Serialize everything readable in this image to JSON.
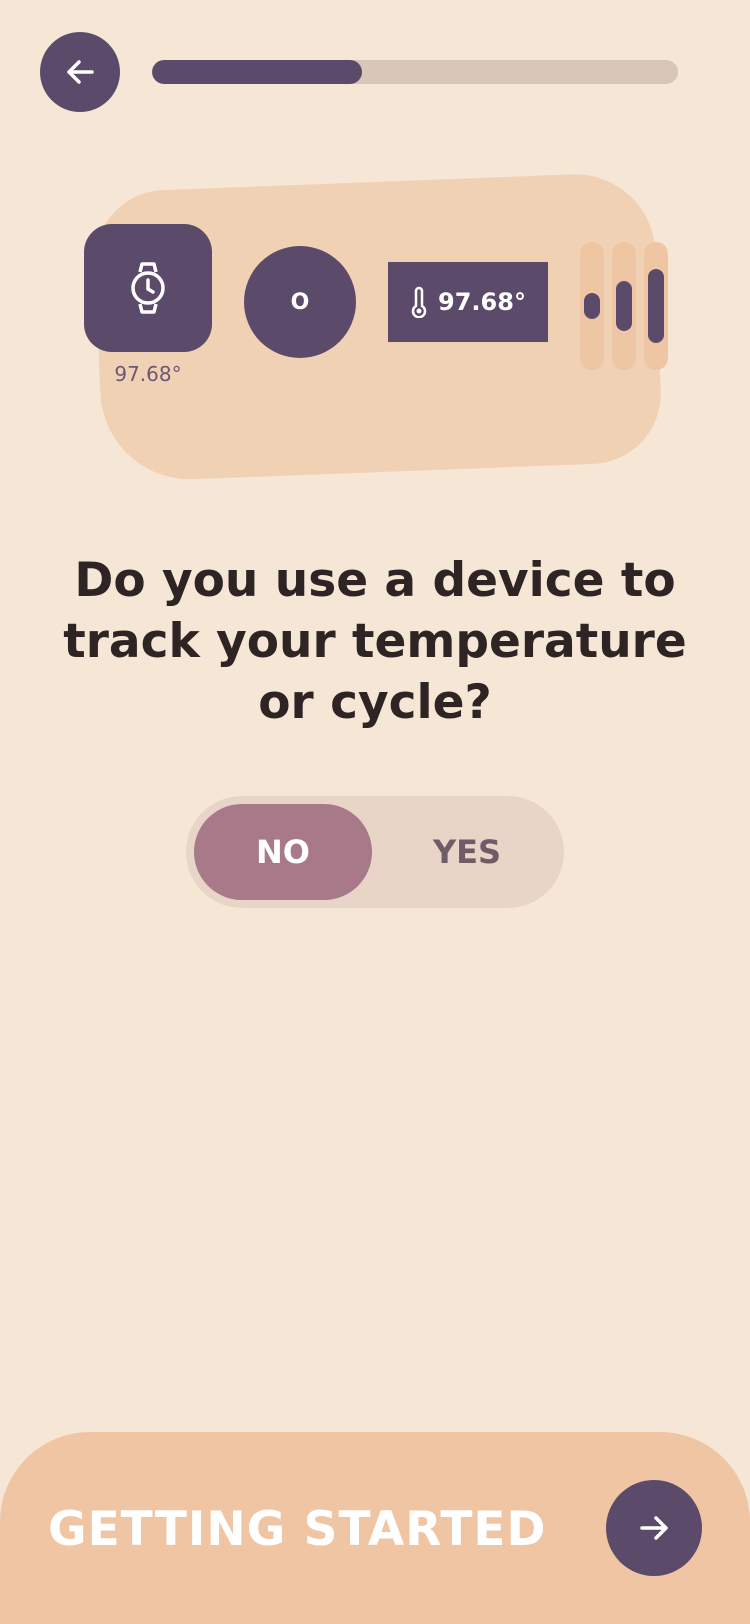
{
  "header": {
    "back_icon": "arrow-left-icon",
    "progress_percent": 40
  },
  "illustration": {
    "watch_icon": "watch-icon",
    "watch_caption": "97.68°",
    "circle_label": "O",
    "thermometer_icon": "thermometer-icon",
    "temperature": "97.68°",
    "bars": [
      {
        "level": "small"
      },
      {
        "level": "medium"
      },
      {
        "level": "large"
      }
    ]
  },
  "question": {
    "text": "Do you use a device to track your temperature or cycle?"
  },
  "toggle": {
    "no_label": "NO",
    "yes_label": "YES",
    "selected": "NO"
  },
  "footer": {
    "label": "GETTING STARTED",
    "next_icon": "arrow-right-icon"
  },
  "colors": {
    "background": "#f5e6d6",
    "primary": "#5c4a6b",
    "accent": "#f0c5a3",
    "selected": "#a87a89"
  }
}
